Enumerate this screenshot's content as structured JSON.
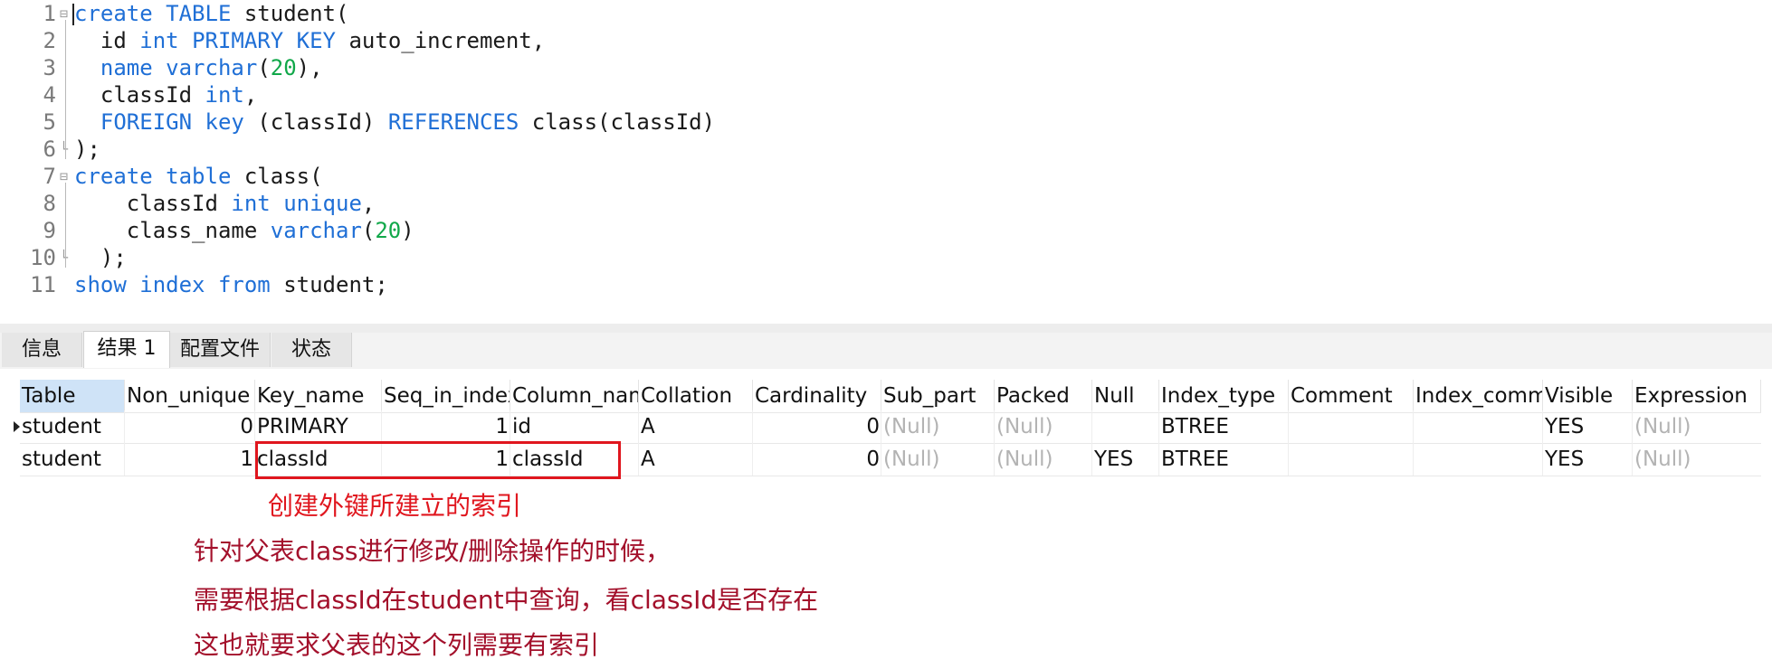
{
  "editor": {
    "lines": [
      {
        "num": "1",
        "fold": "⊟",
        "tokens": [
          [
            "kw",
            "create"
          ],
          [
            "t",
            " "
          ],
          [
            "kw",
            "TABLE"
          ],
          [
            "t",
            " student("
          ]
        ]
      },
      {
        "num": "2",
        "fold": "",
        "tokens": [
          [
            "t",
            "  id "
          ],
          [
            "kw",
            "int"
          ],
          [
            "t",
            " "
          ],
          [
            "kw",
            "PRIMARY KEY"
          ],
          [
            "t",
            " auto_increment,"
          ]
        ]
      },
      {
        "num": "3",
        "fold": "",
        "tokens": [
          [
            "t",
            "  "
          ],
          [
            "kw",
            "name"
          ],
          [
            "t",
            " "
          ],
          [
            "kw",
            "varchar"
          ],
          [
            "t",
            "("
          ],
          [
            "num",
            "20"
          ],
          [
            "t",
            "),"
          ]
        ]
      },
      {
        "num": "4",
        "fold": "",
        "tokens": [
          [
            "t",
            "  classId "
          ],
          [
            "kw",
            "int"
          ],
          [
            "t",
            ","
          ]
        ]
      },
      {
        "num": "5",
        "fold": "",
        "tokens": [
          [
            "t",
            "  "
          ],
          [
            "kw",
            "FOREIGN"
          ],
          [
            "t",
            " "
          ],
          [
            "kw",
            "key"
          ],
          [
            "t",
            " (classId) "
          ],
          [
            "kw",
            "REFERENCES"
          ],
          [
            "t",
            " class(classId)"
          ]
        ]
      },
      {
        "num": "6",
        "fold": "└",
        "tokens": [
          [
            "t",
            ");"
          ]
        ]
      },
      {
        "num": "7",
        "fold": "⊟",
        "tokens": [
          [
            "kw",
            "create"
          ],
          [
            "t",
            " "
          ],
          [
            "kw",
            "table"
          ],
          [
            "t",
            " class("
          ]
        ]
      },
      {
        "num": "8",
        "fold": "",
        "tokens": [
          [
            "t",
            "    classId "
          ],
          [
            "kw",
            "int"
          ],
          [
            "t",
            " "
          ],
          [
            "kw",
            "unique"
          ],
          [
            "t",
            ","
          ]
        ]
      },
      {
        "num": "9",
        "fold": "",
        "tokens": [
          [
            "t",
            "    class_name "
          ],
          [
            "kw",
            "varchar"
          ],
          [
            "t",
            "("
          ],
          [
            "num",
            "20"
          ],
          [
            "t",
            ")"
          ]
        ]
      },
      {
        "num": "10",
        "fold": "└",
        "tokens": [
          [
            "t",
            "  );"
          ]
        ]
      },
      {
        "num": "11",
        "fold": "",
        "tokens": [
          [
            "kw",
            "show"
          ],
          [
            "t",
            " "
          ],
          [
            "kw",
            "index"
          ],
          [
            "t",
            " "
          ],
          [
            "kw",
            "from"
          ],
          [
            "t",
            " student;"
          ]
        ]
      }
    ]
  },
  "tabs": [
    {
      "label": "信息",
      "active": false
    },
    {
      "label": "结果 1",
      "active": true
    },
    {
      "label": "配置文件",
      "active": false
    },
    {
      "label": "状态",
      "active": false
    }
  ],
  "grid": {
    "columns": [
      "Table",
      "Non_unique",
      "Key_name",
      "Seq_in_index",
      "Column_name",
      "Collation",
      "Cardinality",
      "Sub_part",
      "Packed",
      "Null",
      "Index_type",
      "Comment",
      "Index_comment",
      "Visible",
      "Expression"
    ],
    "rows": [
      [
        "student",
        "0",
        "PRIMARY",
        "1",
        "id",
        "A",
        "0",
        "(Null)",
        "(Null)",
        "",
        "BTREE",
        "",
        "",
        "YES",
        "(Null)"
      ],
      [
        "student",
        "1",
        "classId",
        "1",
        "classId",
        "A",
        "0",
        "(Null)",
        "(Null)",
        "YES",
        "BTREE",
        "",
        "",
        "YES",
        "(Null)"
      ]
    ]
  },
  "annotations": {
    "fk_index": "创建外键所建立的索引",
    "line1": "针对父表class进行修改/删除操作的时候，",
    "line2": "需要根据classId在student中查询，看classId是否存在",
    "line3": "这也就要求父表的这个列需要有索引"
  },
  "colors": {
    "keyword": "#1f6fd6",
    "number": "#11a84a",
    "highlight": "#e0161e",
    "annotation": "#a3102b"
  }
}
